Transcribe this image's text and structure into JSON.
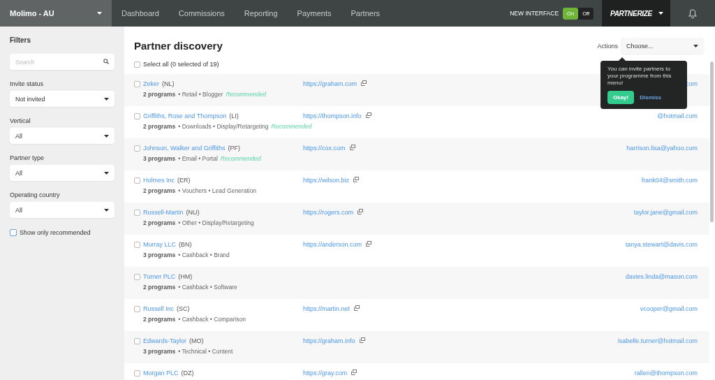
{
  "header": {
    "account": "Molimo - AU",
    "nav": [
      "Dashboard",
      "Commissions",
      "Reporting",
      "Payments",
      "Partners"
    ],
    "interface_label": "NEW INTERFACE",
    "interface_toggle": [
      {
        "label": "On",
        "selected": true
      },
      {
        "label": "Off",
        "selected": false
      }
    ],
    "brand": "PARTNERIZE"
  },
  "filters": {
    "title": "Filters",
    "search": {
      "placeholder": "Search"
    },
    "selects": [
      {
        "label": "Invite status",
        "value": "Not invited"
      },
      {
        "label": "Vertical",
        "value": "All"
      },
      {
        "label": "Partner type",
        "value": "All"
      },
      {
        "label": "Operating country",
        "value": "All"
      }
    ],
    "recommended": {
      "label": "Show only recommended",
      "checked": false
    }
  },
  "page": {
    "title": "Partner discovery",
    "actions_label": "Actions",
    "actions_value": "Choose...",
    "select_all": {
      "label": "Select all (0 selected of 19)",
      "checked": false
    }
  },
  "tooltip": {
    "text": "You can invite partners to your programme from this menu!",
    "ok": "Okay!",
    "dismiss": "Dismiss"
  },
  "partners": [
    {
      "name": "Zeker",
      "code": "(NL)",
      "programs": "2 programs",
      "tags": "• Retail • Blogger",
      "recommended": "Recommended",
      "url": "https://graham.com",
      "email": "com",
      "checked": false
    },
    {
      "name": "Griffiths, Rose and Thompson",
      "code": "(LI)",
      "programs": "2 programs",
      "tags": "• Downloads • Display/Retargeting",
      "recommended": "Recommended",
      "url": "https://thompson.info",
      "email": "@hotmail.com",
      "checked": false
    },
    {
      "name": "Johnson, Walker and Griffiths",
      "code": "(PF)",
      "programs": "3 programs",
      "tags": "• Email • Portal",
      "recommended": "Recommended",
      "url": "https://cox.com",
      "email": "harrison.lisa@yahoo.com",
      "checked": false
    },
    {
      "name": "Holmes Inc",
      "code": "(ER)",
      "programs": "2 programs",
      "tags": "• Vouchers • Lead Generation",
      "url": "https://wilson.biz",
      "email": "frank04@smith.com",
      "checked": false
    },
    {
      "name": "Russell-Martin",
      "code": "(NU)",
      "programs": "2 programs",
      "tags": "• Other • Display/Retargeting",
      "url": "https://rogers.com",
      "email": "taylor.jane@gmail.com",
      "checked": false
    },
    {
      "name": "Murray LLC",
      "code": "(BN)",
      "programs": "3 programs",
      "tags": "• Cashback • Brand",
      "url": "https://anderson.com",
      "email": "tanya.stewart@davis.com",
      "checked": false
    },
    {
      "name": "Turner PLC",
      "code": "(HM)",
      "programs": "2 programs",
      "tags": "• Cashback • Software",
      "email": "davies.linda@mason.com",
      "checked": false
    },
    {
      "name": "Russell Inc",
      "code": "(SC)",
      "programs": "2 programs",
      "tags": "• Cashback • Comparison",
      "url": "https://martin.net",
      "email": "vcooper@gmail.com",
      "checked": false
    },
    {
      "name": "Edwards-Taylor",
      "code": "(MO)",
      "programs": "3 programs",
      "tags": "• Technical • Content",
      "url": "https://graham.info",
      "email": "isabelle.turner@hotmail.com",
      "checked": false
    },
    {
      "name": "Morgan PLC",
      "code": "(DZ)",
      "url": "https://gray.com",
      "email": "rallen@thompson.com",
      "checked": false
    }
  ]
}
